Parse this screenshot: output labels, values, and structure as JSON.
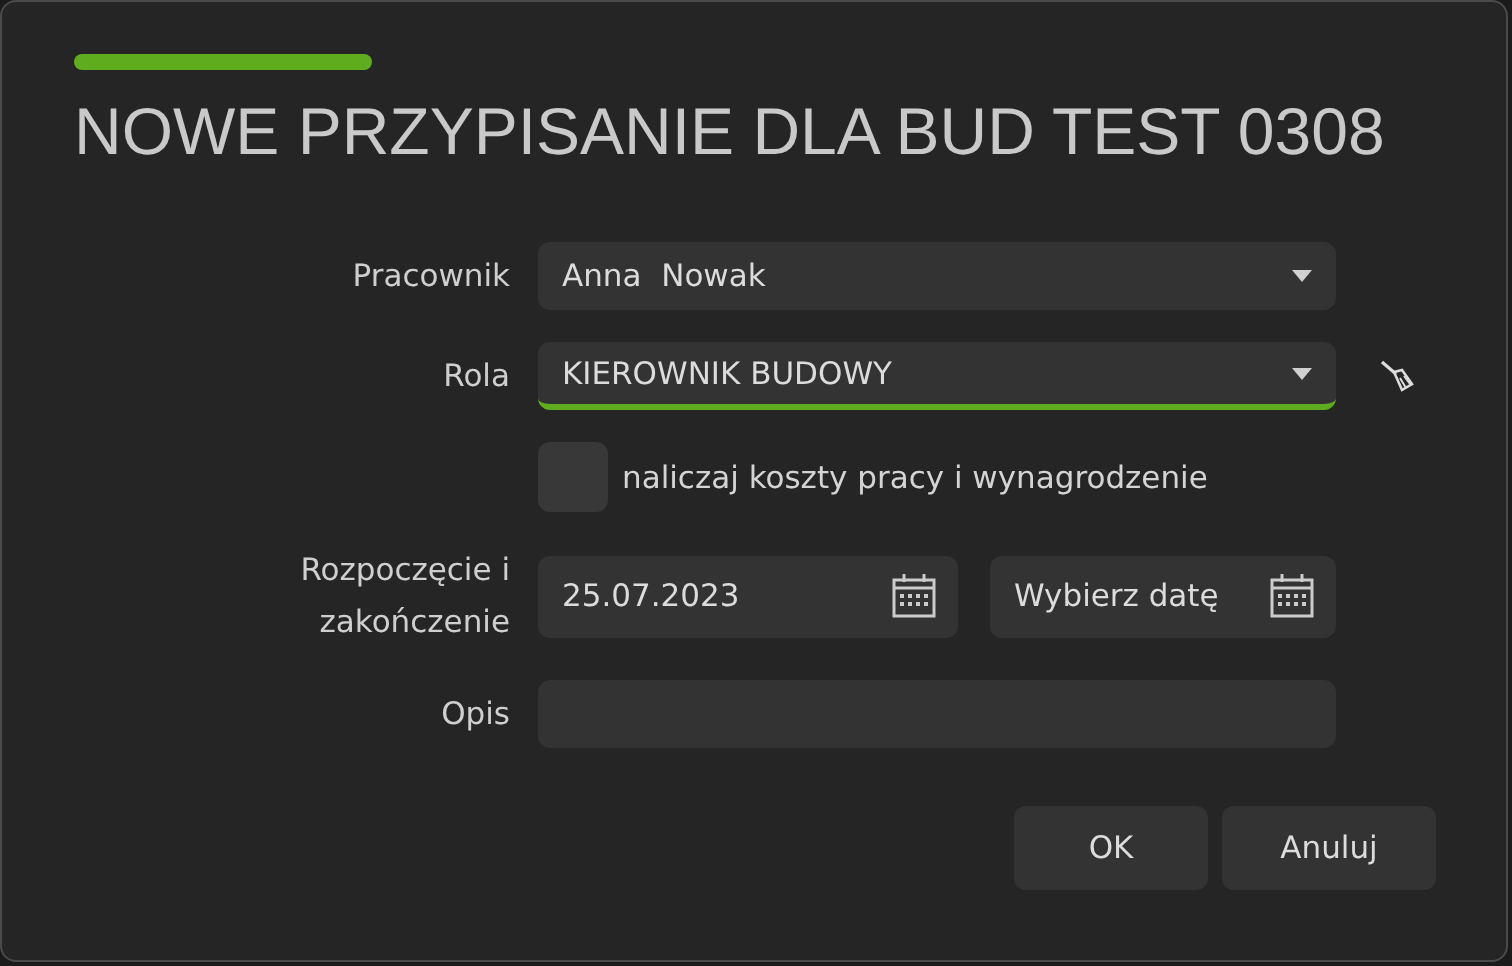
{
  "dialog": {
    "title": "NOWE PRZYPISANIE DLA BUD TEST 0308"
  },
  "employee": {
    "label": "Pracownik",
    "value": "Anna  Nowak",
    "focused": false
  },
  "role": {
    "label": "Rola",
    "value": "KIEROWNIK BUDOWY",
    "focused": true
  },
  "cost_option": {
    "label": "naliczaj koszty pracy i wynagrodzenie",
    "checked": false
  },
  "dates": {
    "label": "Rozpoczęcie i zakończenie",
    "start": {
      "value": "25.07.2023"
    },
    "end": {
      "placeholder": "Wybierz datę"
    }
  },
  "description": {
    "label": "Opis",
    "focused": false
  },
  "buttons": [
    {
      "label": "OK"
    },
    {
      "label": "Anuluj"
    }
  ]
}
